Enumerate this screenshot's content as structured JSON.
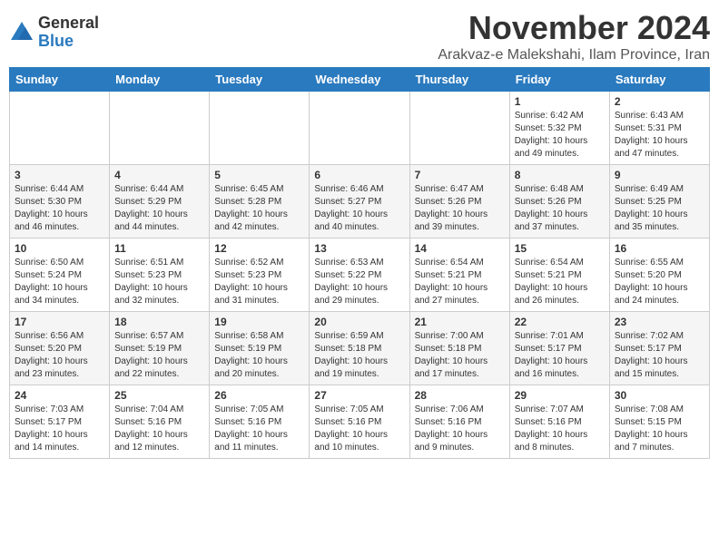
{
  "header": {
    "logo_general": "General",
    "logo_blue": "Blue",
    "month_title": "November 2024",
    "subtitle": "Arakvaz-e Malekshahi, Ilam Province, Iran"
  },
  "weekdays": [
    "Sunday",
    "Monday",
    "Tuesday",
    "Wednesday",
    "Thursday",
    "Friday",
    "Saturday"
  ],
  "weeks": [
    [
      {
        "day": "",
        "info": ""
      },
      {
        "day": "",
        "info": ""
      },
      {
        "day": "",
        "info": ""
      },
      {
        "day": "",
        "info": ""
      },
      {
        "day": "",
        "info": ""
      },
      {
        "day": "1",
        "info": "Sunrise: 6:42 AM\nSunset: 5:32 PM\nDaylight: 10 hours\nand 49 minutes."
      },
      {
        "day": "2",
        "info": "Sunrise: 6:43 AM\nSunset: 5:31 PM\nDaylight: 10 hours\nand 47 minutes."
      }
    ],
    [
      {
        "day": "3",
        "info": "Sunrise: 6:44 AM\nSunset: 5:30 PM\nDaylight: 10 hours\nand 46 minutes."
      },
      {
        "day": "4",
        "info": "Sunrise: 6:44 AM\nSunset: 5:29 PM\nDaylight: 10 hours\nand 44 minutes."
      },
      {
        "day": "5",
        "info": "Sunrise: 6:45 AM\nSunset: 5:28 PM\nDaylight: 10 hours\nand 42 minutes."
      },
      {
        "day": "6",
        "info": "Sunrise: 6:46 AM\nSunset: 5:27 PM\nDaylight: 10 hours\nand 40 minutes."
      },
      {
        "day": "7",
        "info": "Sunrise: 6:47 AM\nSunset: 5:26 PM\nDaylight: 10 hours\nand 39 minutes."
      },
      {
        "day": "8",
        "info": "Sunrise: 6:48 AM\nSunset: 5:26 PM\nDaylight: 10 hours\nand 37 minutes."
      },
      {
        "day": "9",
        "info": "Sunrise: 6:49 AM\nSunset: 5:25 PM\nDaylight: 10 hours\nand 35 minutes."
      }
    ],
    [
      {
        "day": "10",
        "info": "Sunrise: 6:50 AM\nSunset: 5:24 PM\nDaylight: 10 hours\nand 34 minutes."
      },
      {
        "day": "11",
        "info": "Sunrise: 6:51 AM\nSunset: 5:23 PM\nDaylight: 10 hours\nand 32 minutes."
      },
      {
        "day": "12",
        "info": "Sunrise: 6:52 AM\nSunset: 5:23 PM\nDaylight: 10 hours\nand 31 minutes."
      },
      {
        "day": "13",
        "info": "Sunrise: 6:53 AM\nSunset: 5:22 PM\nDaylight: 10 hours\nand 29 minutes."
      },
      {
        "day": "14",
        "info": "Sunrise: 6:54 AM\nSunset: 5:21 PM\nDaylight: 10 hours\nand 27 minutes."
      },
      {
        "day": "15",
        "info": "Sunrise: 6:54 AM\nSunset: 5:21 PM\nDaylight: 10 hours\nand 26 minutes."
      },
      {
        "day": "16",
        "info": "Sunrise: 6:55 AM\nSunset: 5:20 PM\nDaylight: 10 hours\nand 24 minutes."
      }
    ],
    [
      {
        "day": "17",
        "info": "Sunrise: 6:56 AM\nSunset: 5:20 PM\nDaylight: 10 hours\nand 23 minutes."
      },
      {
        "day": "18",
        "info": "Sunrise: 6:57 AM\nSunset: 5:19 PM\nDaylight: 10 hours\nand 22 minutes."
      },
      {
        "day": "19",
        "info": "Sunrise: 6:58 AM\nSunset: 5:19 PM\nDaylight: 10 hours\nand 20 minutes."
      },
      {
        "day": "20",
        "info": "Sunrise: 6:59 AM\nSunset: 5:18 PM\nDaylight: 10 hours\nand 19 minutes."
      },
      {
        "day": "21",
        "info": "Sunrise: 7:00 AM\nSunset: 5:18 PM\nDaylight: 10 hours\nand 17 minutes."
      },
      {
        "day": "22",
        "info": "Sunrise: 7:01 AM\nSunset: 5:17 PM\nDaylight: 10 hours\nand 16 minutes."
      },
      {
        "day": "23",
        "info": "Sunrise: 7:02 AM\nSunset: 5:17 PM\nDaylight: 10 hours\nand 15 minutes."
      }
    ],
    [
      {
        "day": "24",
        "info": "Sunrise: 7:03 AM\nSunset: 5:17 PM\nDaylight: 10 hours\nand 14 minutes."
      },
      {
        "day": "25",
        "info": "Sunrise: 7:04 AM\nSunset: 5:16 PM\nDaylight: 10 hours\nand 12 minutes."
      },
      {
        "day": "26",
        "info": "Sunrise: 7:05 AM\nSunset: 5:16 PM\nDaylight: 10 hours\nand 11 minutes."
      },
      {
        "day": "27",
        "info": "Sunrise: 7:05 AM\nSunset: 5:16 PM\nDaylight: 10 hours\nand 10 minutes."
      },
      {
        "day": "28",
        "info": "Sunrise: 7:06 AM\nSunset: 5:16 PM\nDaylight: 10 hours\nand 9 minutes."
      },
      {
        "day": "29",
        "info": "Sunrise: 7:07 AM\nSunset: 5:16 PM\nDaylight: 10 hours\nand 8 minutes."
      },
      {
        "day": "30",
        "info": "Sunrise: 7:08 AM\nSunset: 5:15 PM\nDaylight: 10 hours\nand 7 minutes."
      }
    ]
  ]
}
